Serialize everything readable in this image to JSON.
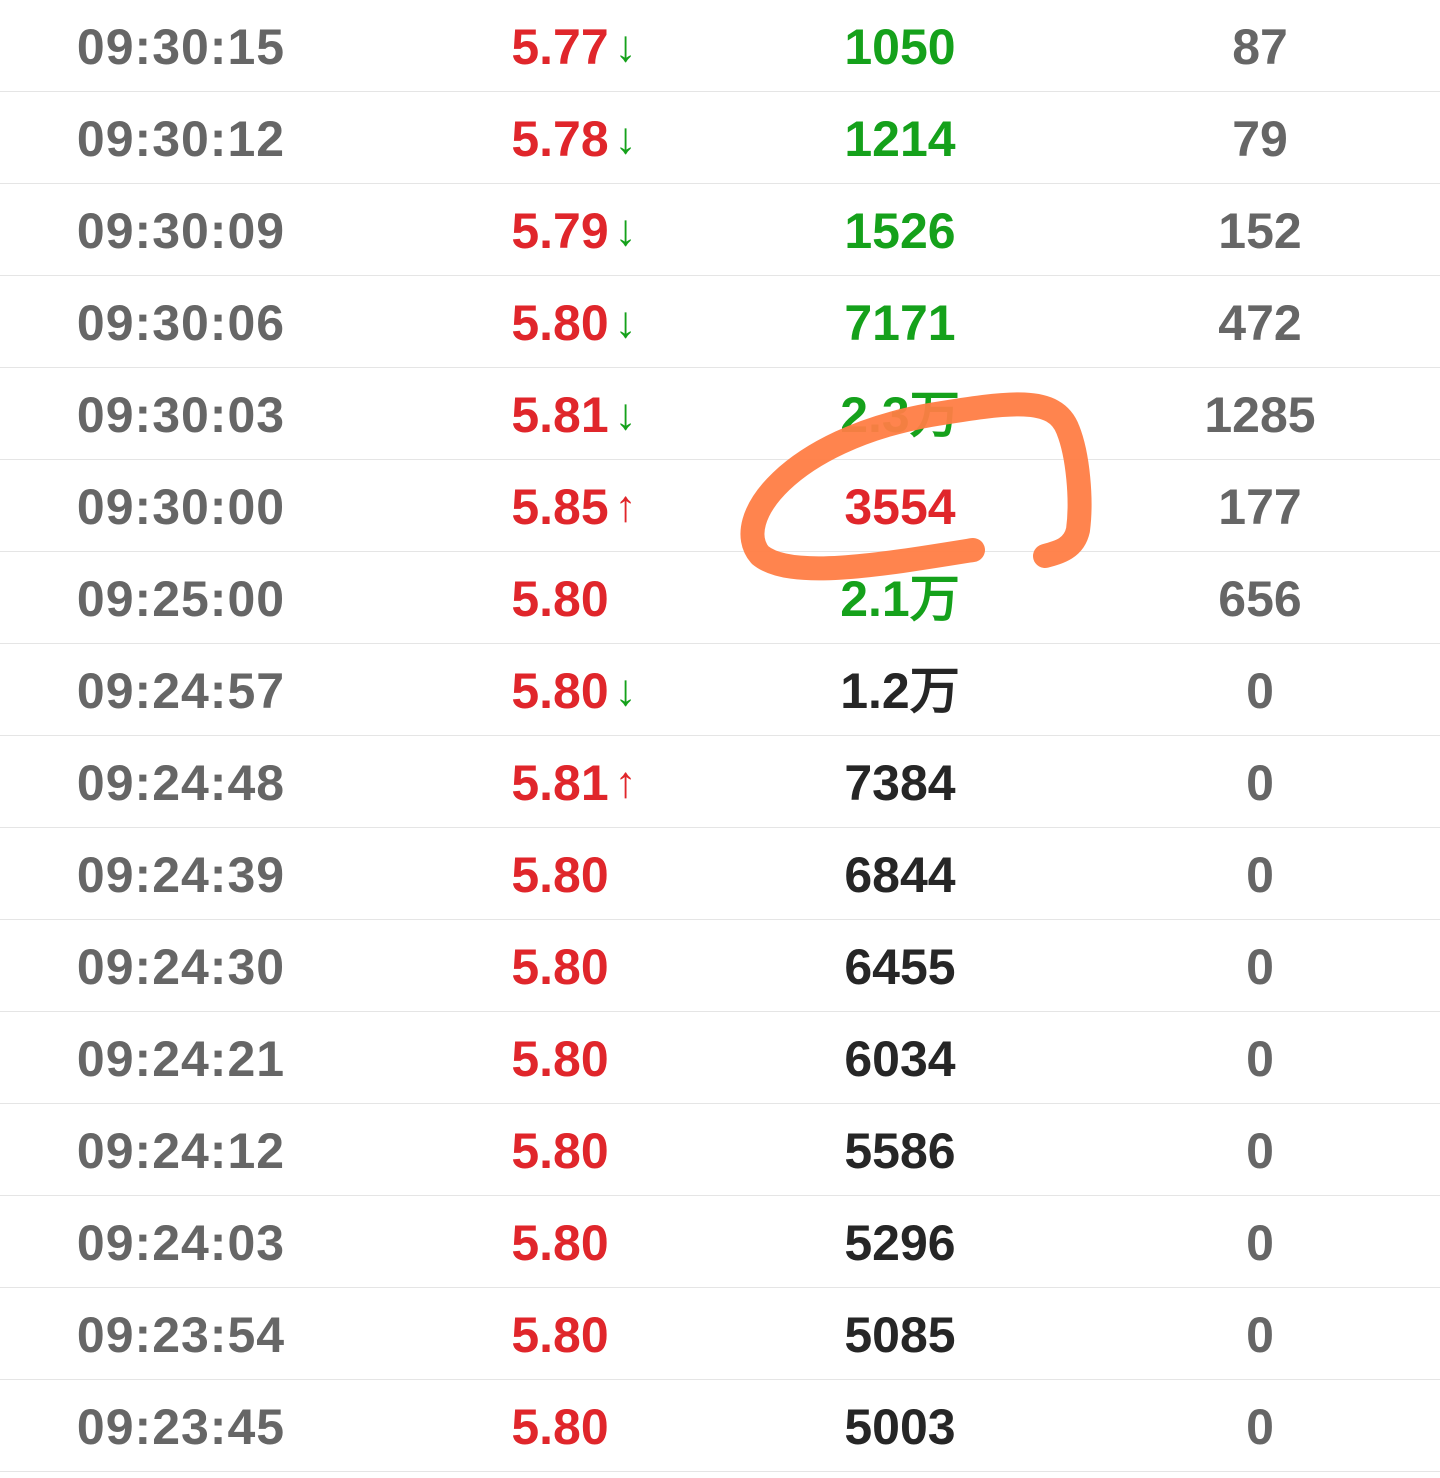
{
  "colors": {
    "up_red": "#e0262b",
    "down_green": "#15a11b",
    "neutral_black": "#262626",
    "time_gray": "#666666",
    "annotation_orange": "#ff7d45"
  },
  "rows": [
    {
      "time": "09:30:15",
      "price": "5.77",
      "arrow": "↓",
      "arrow_dir": "down",
      "volume": "1050",
      "volume_color": "green",
      "count": "87"
    },
    {
      "time": "09:30:12",
      "price": "5.78",
      "arrow": "↓",
      "arrow_dir": "down",
      "volume": "1214",
      "volume_color": "green",
      "count": "79"
    },
    {
      "time": "09:30:09",
      "price": "5.79",
      "arrow": "↓",
      "arrow_dir": "down",
      "volume": "1526",
      "volume_color": "green",
      "count": "152"
    },
    {
      "time": "09:30:06",
      "price": "5.80",
      "arrow": "↓",
      "arrow_dir": "down",
      "volume": "7171",
      "volume_color": "green",
      "count": "472"
    },
    {
      "time": "09:30:03",
      "price": "5.81",
      "arrow": "↓",
      "arrow_dir": "down",
      "volume": "2.3万",
      "volume_color": "green",
      "count": "1285"
    },
    {
      "time": "09:30:00",
      "price": "5.85",
      "arrow": "↑",
      "arrow_dir": "up",
      "volume": "3554",
      "volume_color": "red",
      "count": "177"
    },
    {
      "time": "09:25:00",
      "price": "5.80",
      "arrow": "",
      "arrow_dir": "",
      "volume": "2.1万",
      "volume_color": "green",
      "count": "656"
    },
    {
      "time": "09:24:57",
      "price": "5.80",
      "arrow": "↓",
      "arrow_dir": "down",
      "volume": "1.2万",
      "volume_color": "black",
      "count": "0"
    },
    {
      "time": "09:24:48",
      "price": "5.81",
      "arrow": "↑",
      "arrow_dir": "up",
      "volume": "7384",
      "volume_color": "black",
      "count": "0"
    },
    {
      "time": "09:24:39",
      "price": "5.80",
      "arrow": "",
      "arrow_dir": "",
      "volume": "6844",
      "volume_color": "black",
      "count": "0"
    },
    {
      "time": "09:24:30",
      "price": "5.80",
      "arrow": "",
      "arrow_dir": "",
      "volume": "6455",
      "volume_color": "black",
      "count": "0"
    },
    {
      "time": "09:24:21",
      "price": "5.80",
      "arrow": "",
      "arrow_dir": "",
      "volume": "6034",
      "volume_color": "black",
      "count": "0"
    },
    {
      "time": "09:24:12",
      "price": "5.80",
      "arrow": "",
      "arrow_dir": "",
      "volume": "5586",
      "volume_color": "black",
      "count": "0"
    },
    {
      "time": "09:24:03",
      "price": "5.80",
      "arrow": "",
      "arrow_dir": "",
      "volume": "5296",
      "volume_color": "black",
      "count": "0"
    },
    {
      "time": "09:23:54",
      "price": "5.80",
      "arrow": "",
      "arrow_dir": "",
      "volume": "5085",
      "volume_color": "black",
      "count": "0"
    },
    {
      "time": "09:23:45",
      "price": "5.80",
      "arrow": "",
      "arrow_dir": "",
      "volume": "5003",
      "volume_color": "black",
      "count": "0"
    }
  ]
}
